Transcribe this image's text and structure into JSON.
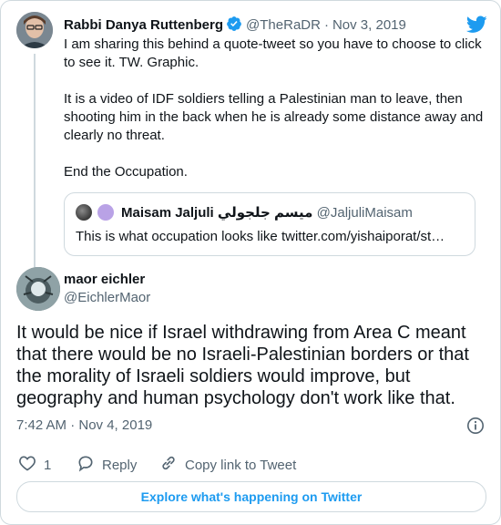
{
  "parent_tweet": {
    "author_name": "Rabbi Danya Ruttenberg",
    "handle": "@TheRaDR",
    "separator": "·",
    "date": "Nov 3, 2019",
    "text": "I am sharing this behind a quote-tweet so you have to choose to click to see it. TW. Graphic.\n\nIt is a video of IDF soldiers telling a Palestinian man to leave, then shooting him in the back when he is already some distance away and clearly no threat.\n\nEnd the Occupation.",
    "quoted_tweet": {
      "author_name": "Maisam Jaljuli ميسم جلجولي",
      "handle": "@JaljuliMaisam",
      "text": "This is what occupation looks like twitter.com/yishaiporat/st…"
    }
  },
  "main_tweet": {
    "author_name": "maor eichler",
    "handle": "@EichlerMaor",
    "text": "It would be nice if Israel withdrawing from Area C meant that there would be no Israeli-Palestinian borders or that the morality of Israeli soldiers would improve, but geography and human psychology don't work like that.",
    "timestamp": "7:42 AM · Nov 4, 2019"
  },
  "actions": {
    "like_count": "1",
    "reply_label": "Reply",
    "copy_link_label": "Copy link to Tweet"
  },
  "explore_button": "Explore what's happening on Twitter",
  "icons": {
    "verified": "verified-badge-icon",
    "brand": "twitter-bird-icon",
    "info": "info-icon",
    "like": "heart-icon",
    "reply": "reply-bubble-icon",
    "link": "link-icon"
  },
  "colors": {
    "accent": "#1d9bf0",
    "text": "#0f1419",
    "secondary": "#536471",
    "border": "#cfd9de"
  }
}
